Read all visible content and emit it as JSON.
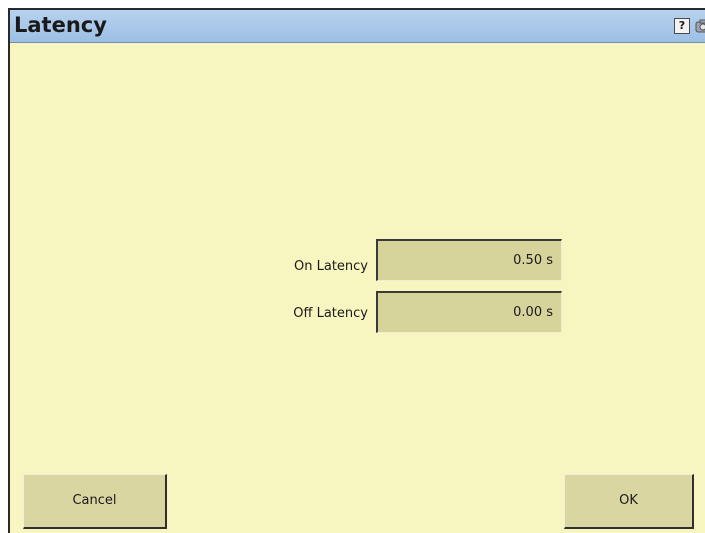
{
  "window": {
    "title": "Latency",
    "help_icon_label": "?"
  },
  "fields": [
    {
      "label": "On Latency",
      "value": "0.50 s"
    },
    {
      "label": "Off Latency",
      "value": "0.00 s"
    }
  ],
  "buttons": {
    "cancel": "Cancel",
    "ok": "OK"
  },
  "colors": {
    "background": "#f7f5c0",
    "titlebar": "#9dbfe6",
    "field": "#d7d49b",
    "button": "#d9d6a2"
  }
}
